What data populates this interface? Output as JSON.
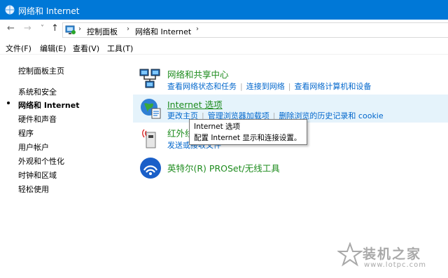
{
  "window": {
    "title": "网络和 Internet"
  },
  "nav": {
    "back_icon": "←",
    "forward_icon": "→",
    "recent_icon": "˅",
    "up_icon": "↑",
    "breadcrumbs": [
      "控制面板",
      "网络和 Internet"
    ],
    "separator": "›"
  },
  "menu": [
    "文件(F)",
    "编辑(E)",
    "查看(V)",
    "工具(T)"
  ],
  "sidebar": {
    "items": [
      {
        "label": "控制面板主页"
      },
      {
        "label": "系统和安全"
      },
      {
        "label": "网络和 Internet",
        "current": true
      },
      {
        "label": "硬件和声音"
      },
      {
        "label": "程序"
      },
      {
        "label": "用户帐户"
      },
      {
        "label": "外观和个性化"
      },
      {
        "label": "时钟和区域"
      },
      {
        "label": "轻松使用"
      }
    ]
  },
  "categories": [
    {
      "title": "网络和共享中心",
      "icon": "network-sharing-center-icon",
      "links": [
        "查看网络状态和任务",
        "连接到网络",
        "查看网络计算机和设备"
      ]
    },
    {
      "title": "Internet 选项",
      "icon": "internet-options-icon",
      "hovered": true,
      "links": [
        "更改主页",
        "管理浏览器加载项",
        "删除浏览的历史记录和 cookie"
      ]
    },
    {
      "title": "红外线",
      "icon": "infrared-icon",
      "links": [
        "发送或接收文件"
      ]
    },
    {
      "title": "英特尔(R) PROSet/无线工具",
      "icon": "intel-wireless-icon",
      "links": []
    }
  ],
  "tooltip": {
    "line1": "Internet 选项",
    "line2": "配置 Internet 显示和连接设置。"
  },
  "watermark": {
    "name": "装机之家",
    "url": "www.lotpc.com"
  },
  "colors": {
    "titlebar": "#0078d7",
    "category_title": "#1e8c1e",
    "link": "#0066cc",
    "hover_bg": "#e5f3fb"
  }
}
